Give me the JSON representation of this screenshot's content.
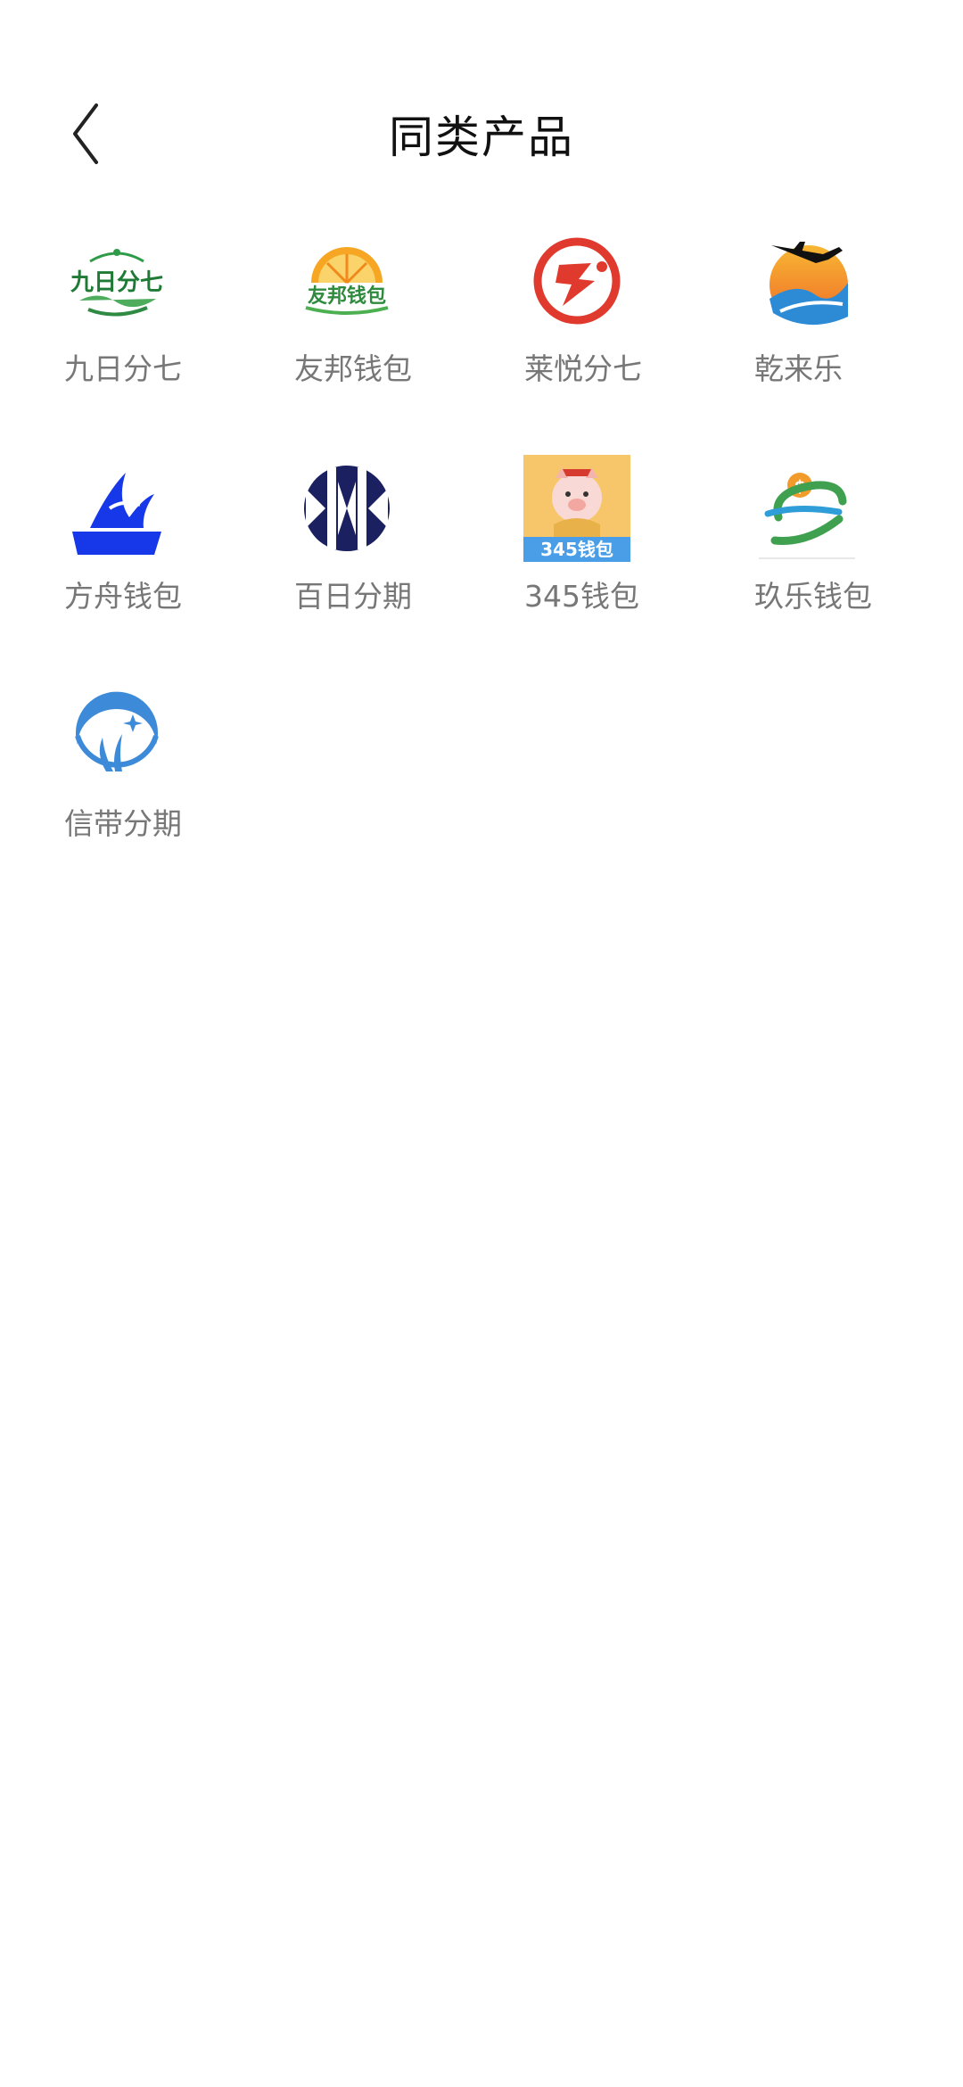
{
  "header": {
    "title": "同类产品",
    "back_icon": "chevron-left-icon"
  },
  "products": [
    {
      "label": "九日分七",
      "icon": "jiuri-fenqi-logo",
      "logo_text": "九日分七"
    },
    {
      "label": "友邦钱包",
      "icon": "youbang-qianbao-logo",
      "logo_text": "友邦钱包"
    },
    {
      "label": "莱悦分七",
      "icon": "laiyue-fenqi-logo"
    },
    {
      "label": "乾来乐",
      "icon": "qianlaile-logo"
    },
    {
      "label": "方舟钱包",
      "icon": "fangzhou-qianbao-logo"
    },
    {
      "label": "百日分期",
      "icon": "bairi-fenqi-logo"
    },
    {
      "label": "345钱包",
      "icon": "pig-logo",
      "logo_text": "345钱包"
    },
    {
      "label": "玖乐钱包",
      "icon": "jiule-qianbao-logo"
    },
    {
      "label": "信带分期",
      "icon": "xindai-fenqi-logo"
    }
  ],
  "colors": {
    "title": "#111111",
    "label": "#777777",
    "background": "#ffffff"
  }
}
